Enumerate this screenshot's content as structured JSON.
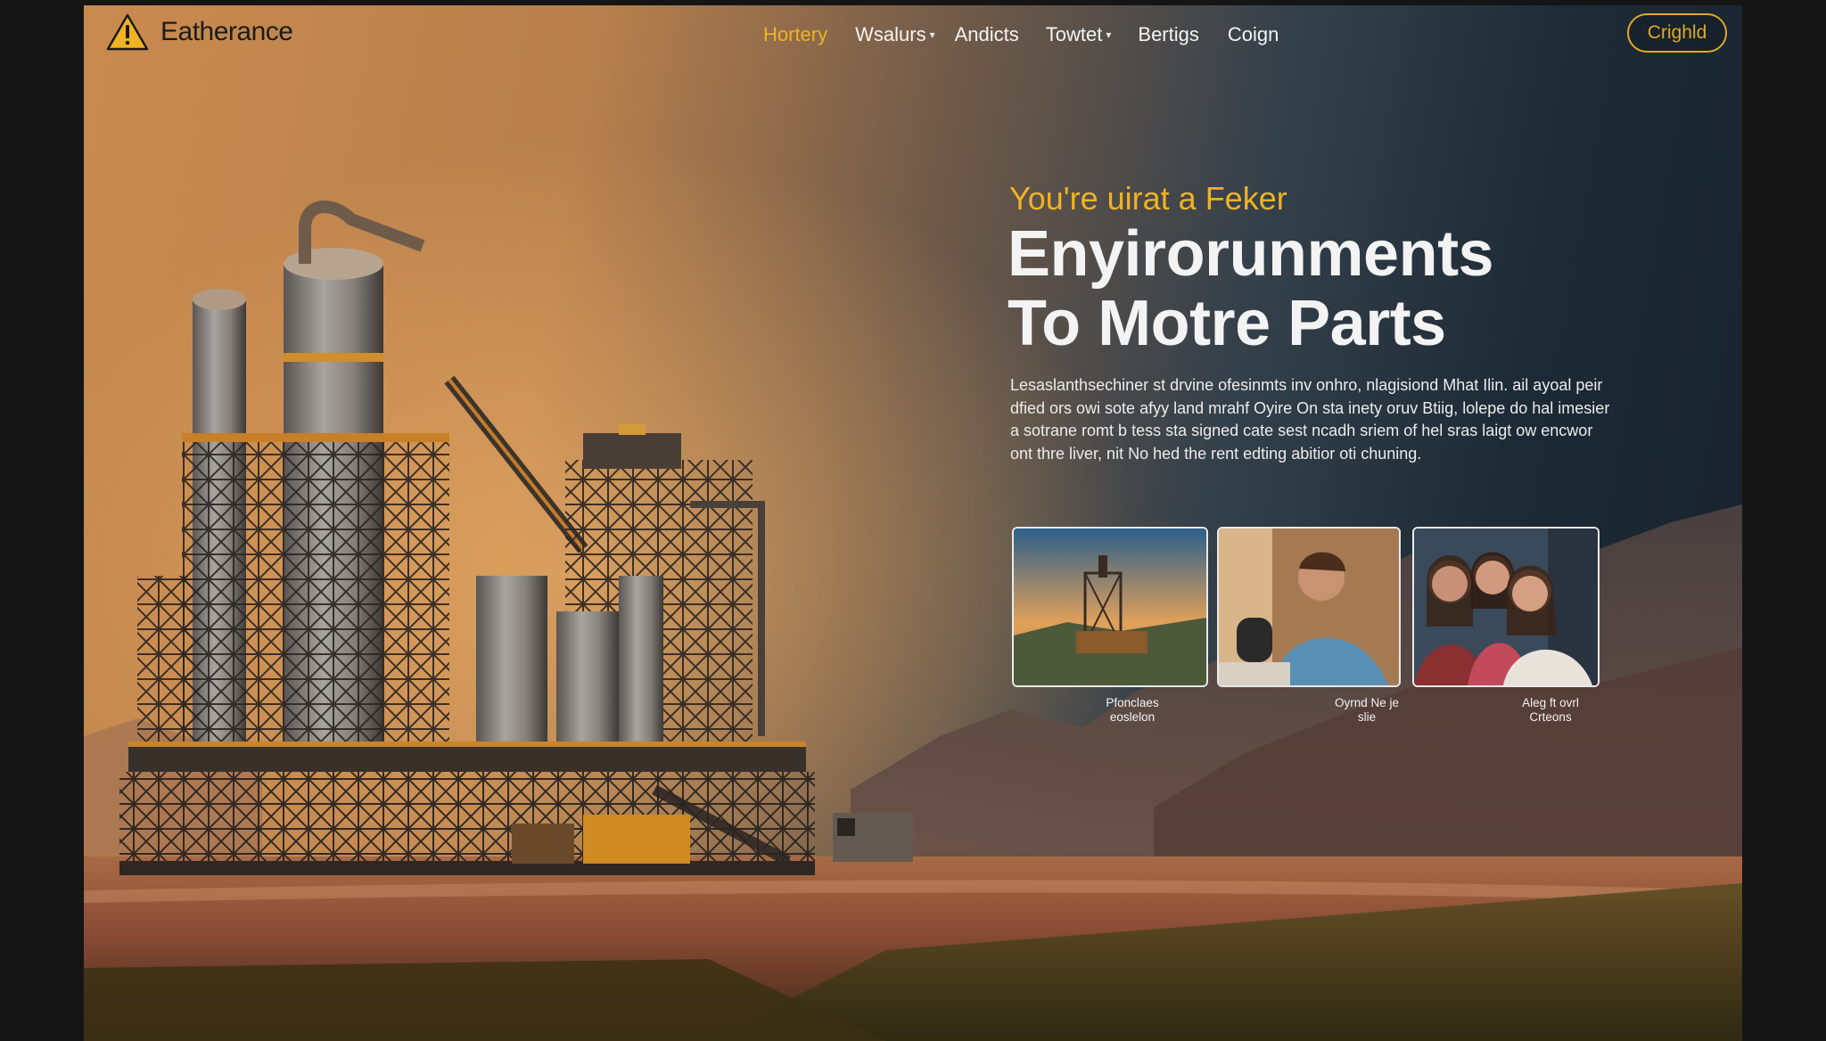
{
  "brand": {
    "name": "Eatherance",
    "logo_icon": "warning-triangle-icon",
    "accent": "#f0b323"
  },
  "nav": {
    "items": [
      {
        "label": "Hortery",
        "active": true,
        "dropdown": false
      },
      {
        "label": "Wsalurs",
        "active": false,
        "dropdown": true
      },
      {
        "label": "Andicts",
        "active": false,
        "dropdown": false
      },
      {
        "label": "Towtet",
        "active": false,
        "dropdown": true
      },
      {
        "label": "Bertigs",
        "active": false,
        "dropdown": false
      },
      {
        "label": "Coign",
        "active": false,
        "dropdown": false
      }
    ],
    "cta_label": "Crighld"
  },
  "hero": {
    "eyebrow": "You're uirat a Feker",
    "headline_line1": "Enyirorunments",
    "headline_line2": "To Motre Parts",
    "description": "Lesaslanthsechiner st drvine ofesinmts inv onhro, nlagisiond Mhat Ilin. ail ayoal peir dfied ors owi sote afyy land mrahf Oyire On sta inety oruv Btiig, lolepe do hal imesier a sotrane romt b tess sta signed cate sest ncadh sriem of hel sras laigt ow encwor ont thre liver, nit No hed the rent edting abitior oti chuning."
  },
  "cards": [
    {
      "caption_line1": "Pfonclaes",
      "caption_line2": "eoslelon",
      "image": "industrial-rig-photo"
    },
    {
      "caption_line1": "Oyrnd Ne je",
      "caption_line2": "slie",
      "image": "man-working-photo"
    },
    {
      "caption_line1": "Aleg ft ovrl",
      "caption_line2": "Crteons",
      "image": "three-women-photo"
    }
  ]
}
